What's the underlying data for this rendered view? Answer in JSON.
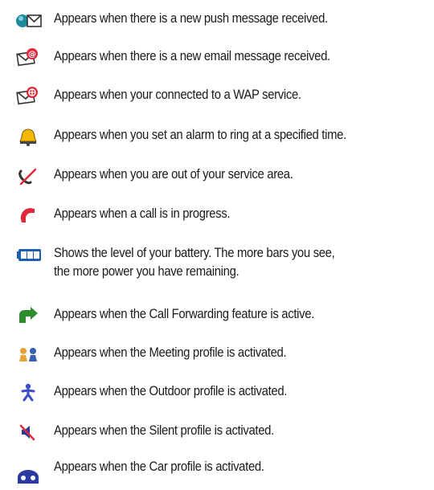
{
  "items": [
    {
      "icon": "push-message-icon",
      "text": "Appears when there is a new push message received."
    },
    {
      "icon": "email-message-icon",
      "text": "Appears when there is a new email message received."
    },
    {
      "icon": "wap-service-icon",
      "text": "Appears when your connected to a WAP service."
    },
    {
      "icon": "alarm-bell-icon",
      "text": "Appears when you set an alarm to ring at a specified time."
    },
    {
      "icon": "no-service-icon",
      "text": "Appears when you are out of your service area."
    },
    {
      "icon": "call-in-progress-icon",
      "text": "Appears when a call is in progress."
    },
    {
      "icon": "battery-level-icon",
      "text": "Shows the level of your battery. The more bars you see,",
      "text2": "the more power you have remaining."
    },
    {
      "icon": "call-forwarding-icon",
      "text": "Appears when the Call Forwarding feature is active."
    },
    {
      "icon": "meeting-profile-icon",
      "text": "Appears when the Meeting profile is activated."
    },
    {
      "icon": "outdoor-profile-icon",
      "text": "Appears when the Outdoor profile is activated."
    },
    {
      "icon": "silent-profile-icon",
      "text": "Appears when the Silent profile is activated."
    },
    {
      "icon": "car-profile-icon",
      "text": "Appears when the Car profile is activated."
    }
  ]
}
